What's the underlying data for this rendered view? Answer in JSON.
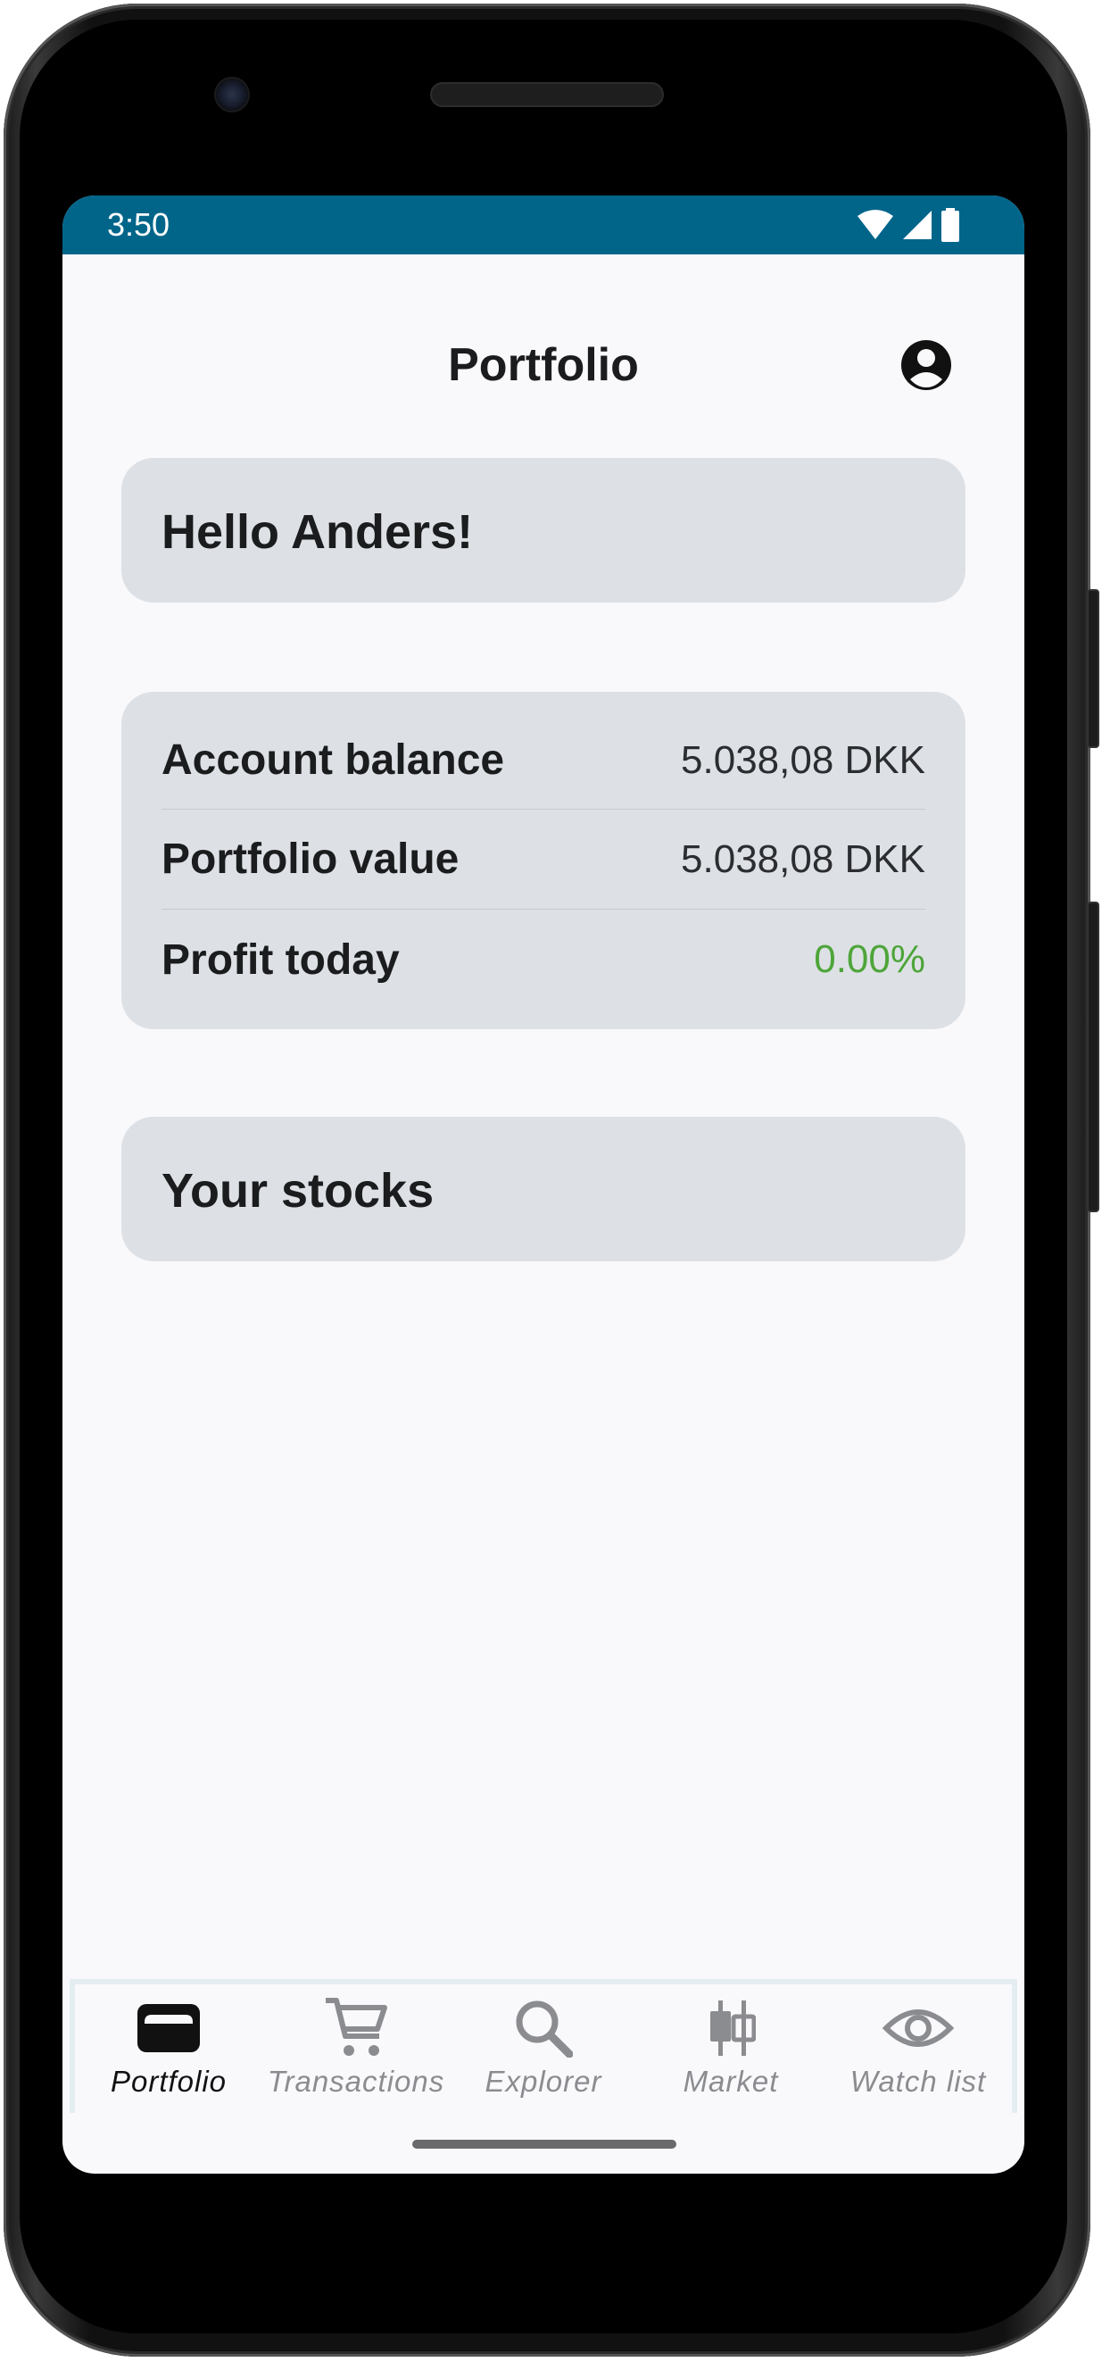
{
  "status_bar": {
    "time": "3:50",
    "background": "#01658a",
    "icons": [
      "wifi-icon",
      "cell-signal-icon",
      "battery-icon"
    ]
  },
  "header": {
    "title": "Portfolio",
    "profile_icon": "account-circle-icon"
  },
  "greeting": {
    "text": "Hello Anders!"
  },
  "summary": {
    "rows": [
      {
        "label": "Account balance",
        "value": "5.038,08 DKK"
      },
      {
        "label": "Portfolio value",
        "value": "5.038,08 DKK"
      },
      {
        "label": "Profit today",
        "value": "0.00%"
      }
    ],
    "profit_color": "#4ea53a"
  },
  "stocks": {
    "heading": "Your stocks"
  },
  "bottom_nav": {
    "items": [
      {
        "label": "Portfolio",
        "icon": "wallet-icon",
        "active": true
      },
      {
        "label": "Transactions",
        "icon": "cart-icon",
        "active": false
      },
      {
        "label": "Explorer",
        "icon": "search-icon",
        "active": false
      },
      {
        "label": "Market",
        "icon": "candlestick-icon",
        "active": false
      },
      {
        "label": "Watch list",
        "icon": "eye-icon",
        "active": false
      }
    ]
  }
}
